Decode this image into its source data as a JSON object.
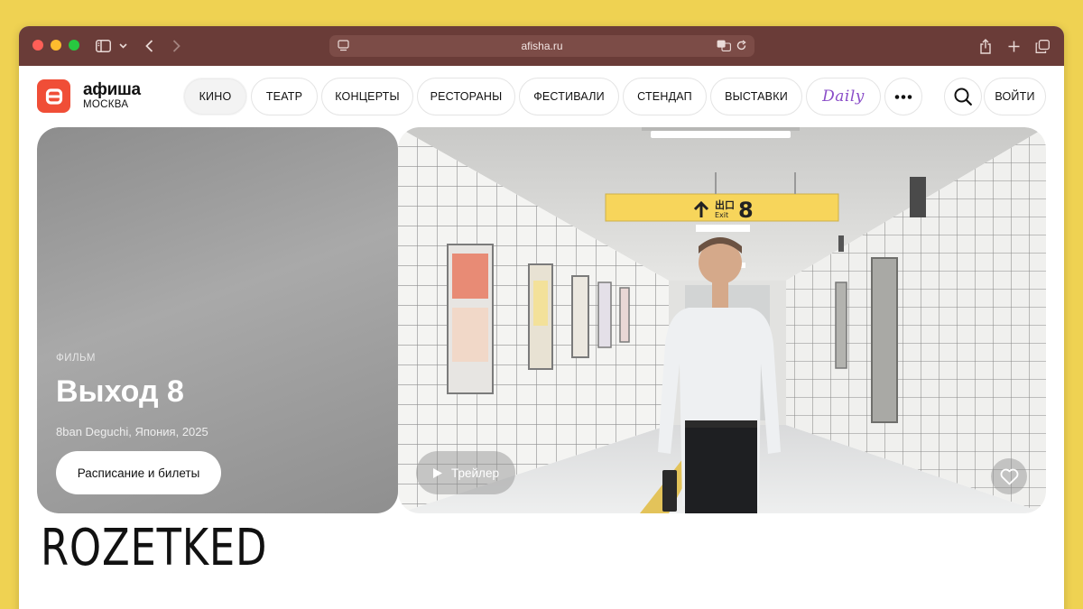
{
  "browser": {
    "url": "afisha.ru"
  },
  "site": {
    "logo_letter": "а",
    "logo_name": "афиша",
    "city": "МОСКВА",
    "nav": [
      {
        "label": "КИНО",
        "active": true
      },
      {
        "label": "ТЕАТР"
      },
      {
        "label": "КОНЦЕРТЫ"
      },
      {
        "label": "РЕСТОРАНЫ"
      },
      {
        "label": "ФЕСТИВАЛИ"
      },
      {
        "label": "СТЕНДАП"
      },
      {
        "label": "ВЫСТАВКИ"
      },
      {
        "label": "Daily"
      }
    ],
    "more_icon": "more-dots-icon",
    "search_icon": "search-icon",
    "login_label": "ВОЙТИ",
    "accent_color": "#F04E37",
    "titlebar_color": "#6A3C38"
  },
  "hero": {
    "kicker": "ФИЛЬМ",
    "title": "Выход 8",
    "meta": "8ban Deguchi, Япония, 2025",
    "cta_label": "Расписание и билеты",
    "trailer_label": "Трейлер",
    "sign_text": "出口",
    "sign_exit": "Exit",
    "sign_number": "8"
  },
  "watermark": "ROZETKED"
}
